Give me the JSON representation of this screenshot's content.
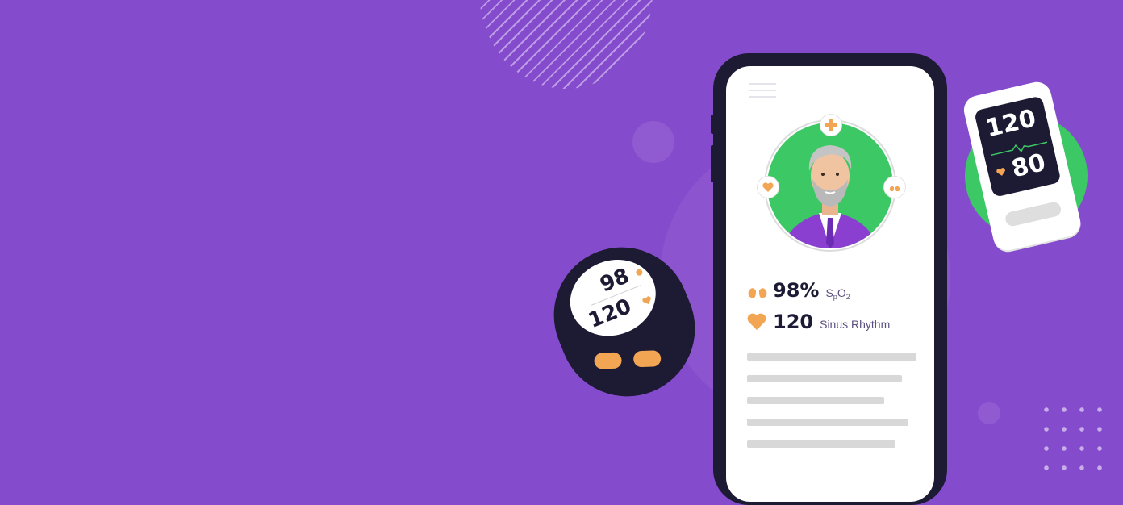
{
  "colors": {
    "background": "#854bcd",
    "phone_frame": "#1d1a33",
    "accent_green": "#3cc965",
    "accent_orange": "#f2a553",
    "text_dark": "#1c1a35"
  },
  "phone": {
    "profile": {
      "icons": [
        "plus-icon",
        "heart-icon",
        "lungs-icon"
      ]
    },
    "stats": [
      {
        "icon": "lungs-icon",
        "value": "98%",
        "label_main": "S",
        "label_sub1": "p",
        "label_mid": "O",
        "label_sub2": "2"
      },
      {
        "icon": "heart-icon",
        "value": "120",
        "label": "Sinus Rhythm"
      }
    ]
  },
  "bp_monitor": {
    "systolic": "120",
    "diastolic": "80"
  },
  "oximeter": {
    "spo2": "98",
    "pulse": "120"
  }
}
